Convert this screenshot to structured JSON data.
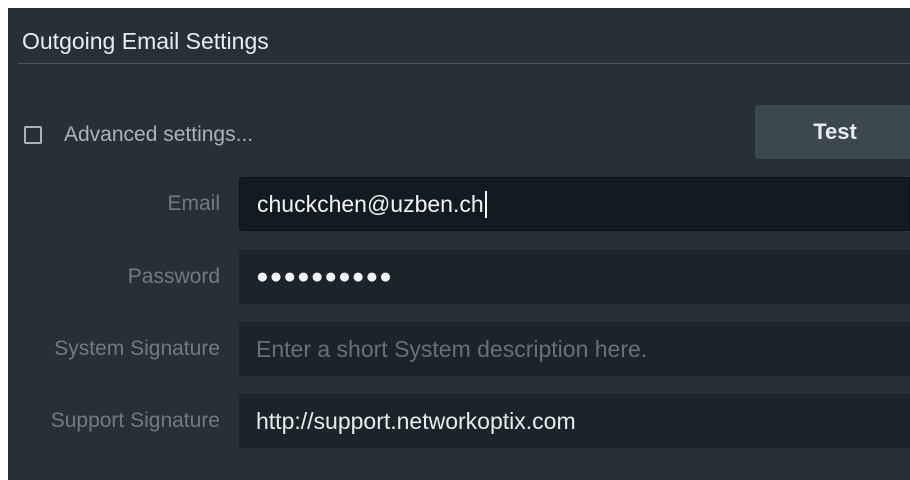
{
  "section": {
    "title": "Outgoing Email Settings"
  },
  "advanced": {
    "label": "Advanced settings...",
    "checked": false
  },
  "test_button": {
    "label": "Test"
  },
  "fields": {
    "email": {
      "label": "Email",
      "value": "chuckchen@uzben.ch"
    },
    "password": {
      "label": "Password",
      "masked_value": "●●●●●●●●●●"
    },
    "system_signature": {
      "label": "System Signature",
      "placeholder": "Enter a short System description here."
    },
    "support_signature": {
      "label": "Support Signature",
      "value": "http://support.networkoptix.com"
    }
  },
  "colors": {
    "panel_bg": "#263137",
    "field_bg": "#1b2529",
    "focused_field_bg": "#121b1f",
    "button_bg": "#3b4850",
    "label_text": "#717c82",
    "primary_text": "#e8ecee"
  }
}
